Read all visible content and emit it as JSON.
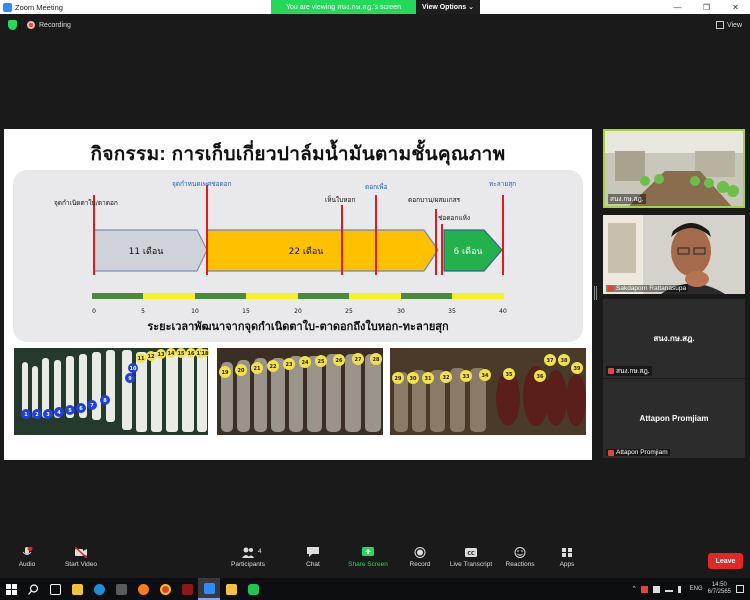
{
  "window": {
    "title": "Zoom Meeting",
    "minimize": "—",
    "maximize": "❐",
    "close": "✕"
  },
  "banner": {
    "viewing_text": "You are viewing สนง.กษ.สฎ.'s screen",
    "view_options": "View Options ⌄"
  },
  "top": {
    "recording": "Recording",
    "view": "View"
  },
  "slide": {
    "title": "กิจกรรม: การเก็บเกี่ยวปาล์มน้ำมันตามชั้นคุณภาพ",
    "subtitle": "ระยะเวลาพัฒนาจากจุดกำเนิดตาใบ-ตาดอกถึงใบหอก-ทะลายสุก",
    "labels": {
      "origin": "จุดกำเนิดตาใบ/ตาดอก",
      "sex": "จุดกำหนดเพศช่อดอก",
      "spear": "เห็นใบหอก",
      "bloom": "ดอกบาน/ผสมเกสร",
      "flower": "ดอกบาน/ผสมเกสร",
      "dry": "ช่อดอกแห้ง",
      "ripe": "ทะลายสุก"
    },
    "bloom_label": "ดอกเพื่อ",
    "phases": [
      {
        "label": "11 เดือน",
        "color": "#cfd2d8"
      },
      {
        "label": "22 เดือน",
        "color": "#ffc000"
      },
      {
        "label": "6 เดือน",
        "color": "#22b14c"
      }
    ],
    "ticks": [
      "0",
      "5",
      "10",
      "15",
      "20",
      "25",
      "30",
      "35",
      "40"
    ],
    "photo_numbers": {
      "p1": [
        "1",
        "2",
        "3",
        "4",
        "5",
        "6",
        "7",
        "8",
        "9",
        "10",
        "11",
        "12",
        "13",
        "14",
        "15",
        "16",
        "17",
        "18"
      ],
      "p2": [
        "19",
        "20",
        "21",
        "22",
        "23",
        "24",
        "25",
        "26",
        "27",
        "28"
      ],
      "p3": [
        "29",
        "30",
        "31",
        "32",
        "33",
        "34",
        "35",
        "36",
        "37",
        "38",
        "39"
      ]
    }
  },
  "participants": [
    {
      "name": "สนง.กษ.สฎ.",
      "type": "video-room"
    },
    {
      "name": "Sakdaporn Rattanasupa",
      "type": "video-person"
    },
    {
      "name": "สนง.กษ.สฎ.",
      "center": "สนง.กษ.สฎ.",
      "type": "name"
    },
    {
      "name": "Attapon Promjiam",
      "center": "Attapon Promjiam",
      "type": "name"
    }
  ],
  "toolbar": {
    "audio": "Audio",
    "video": "Start Video",
    "participants": "Participants",
    "participants_count": "4",
    "chat": "Chat",
    "share": "Share Screen",
    "record": "Record",
    "transcript": "Live Transcript",
    "reactions": "Reactions",
    "apps": "Apps",
    "leave": "Leave",
    "audio_badge": "!"
  },
  "taskbar": {
    "lang": "ENG",
    "time": "14:50",
    "date": "6/7/2565"
  },
  "colors": {
    "zoom_green": "#23d959",
    "leave_red": "#e02828",
    "active_border": "#a4d43c"
  }
}
